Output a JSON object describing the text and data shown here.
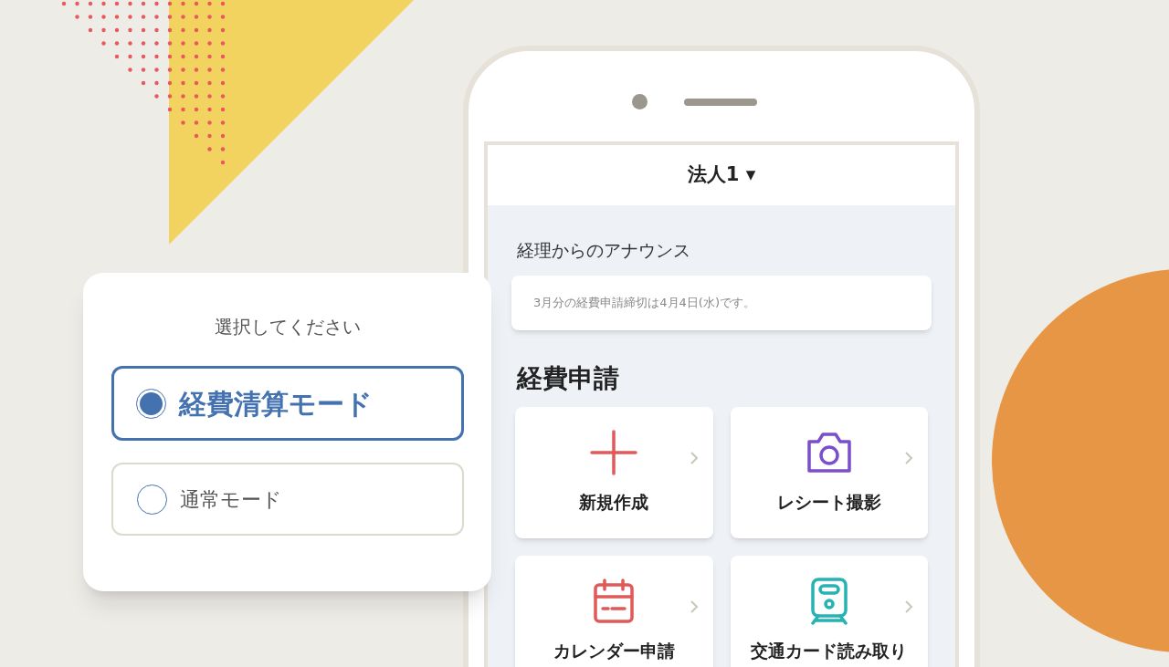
{
  "phone": {
    "header": {
      "title": "法人1 ▾"
    },
    "announcement": {
      "heading": "経理からのアナウンス",
      "message": "3月分の経費申請締切は4月4日(水)です。"
    },
    "section_title": "経費申請",
    "tiles": [
      {
        "label": "新規作成",
        "kind": "plus",
        "color": "#e05a5a"
      },
      {
        "label": "レシート撮影",
        "kind": "camera",
        "color": "#7b4fc9"
      },
      {
        "label": "カレンダー申請",
        "kind": "calendar",
        "color": "#e05a5a"
      },
      {
        "label": "交通カード読み取り",
        "kind": "train",
        "color": "#27b3b3"
      }
    ]
  },
  "mode_dialog": {
    "title": "選択してください",
    "options": [
      {
        "label": "経費清算モード",
        "selected": true
      },
      {
        "label": "通常モード",
        "selected": false
      }
    ]
  }
}
